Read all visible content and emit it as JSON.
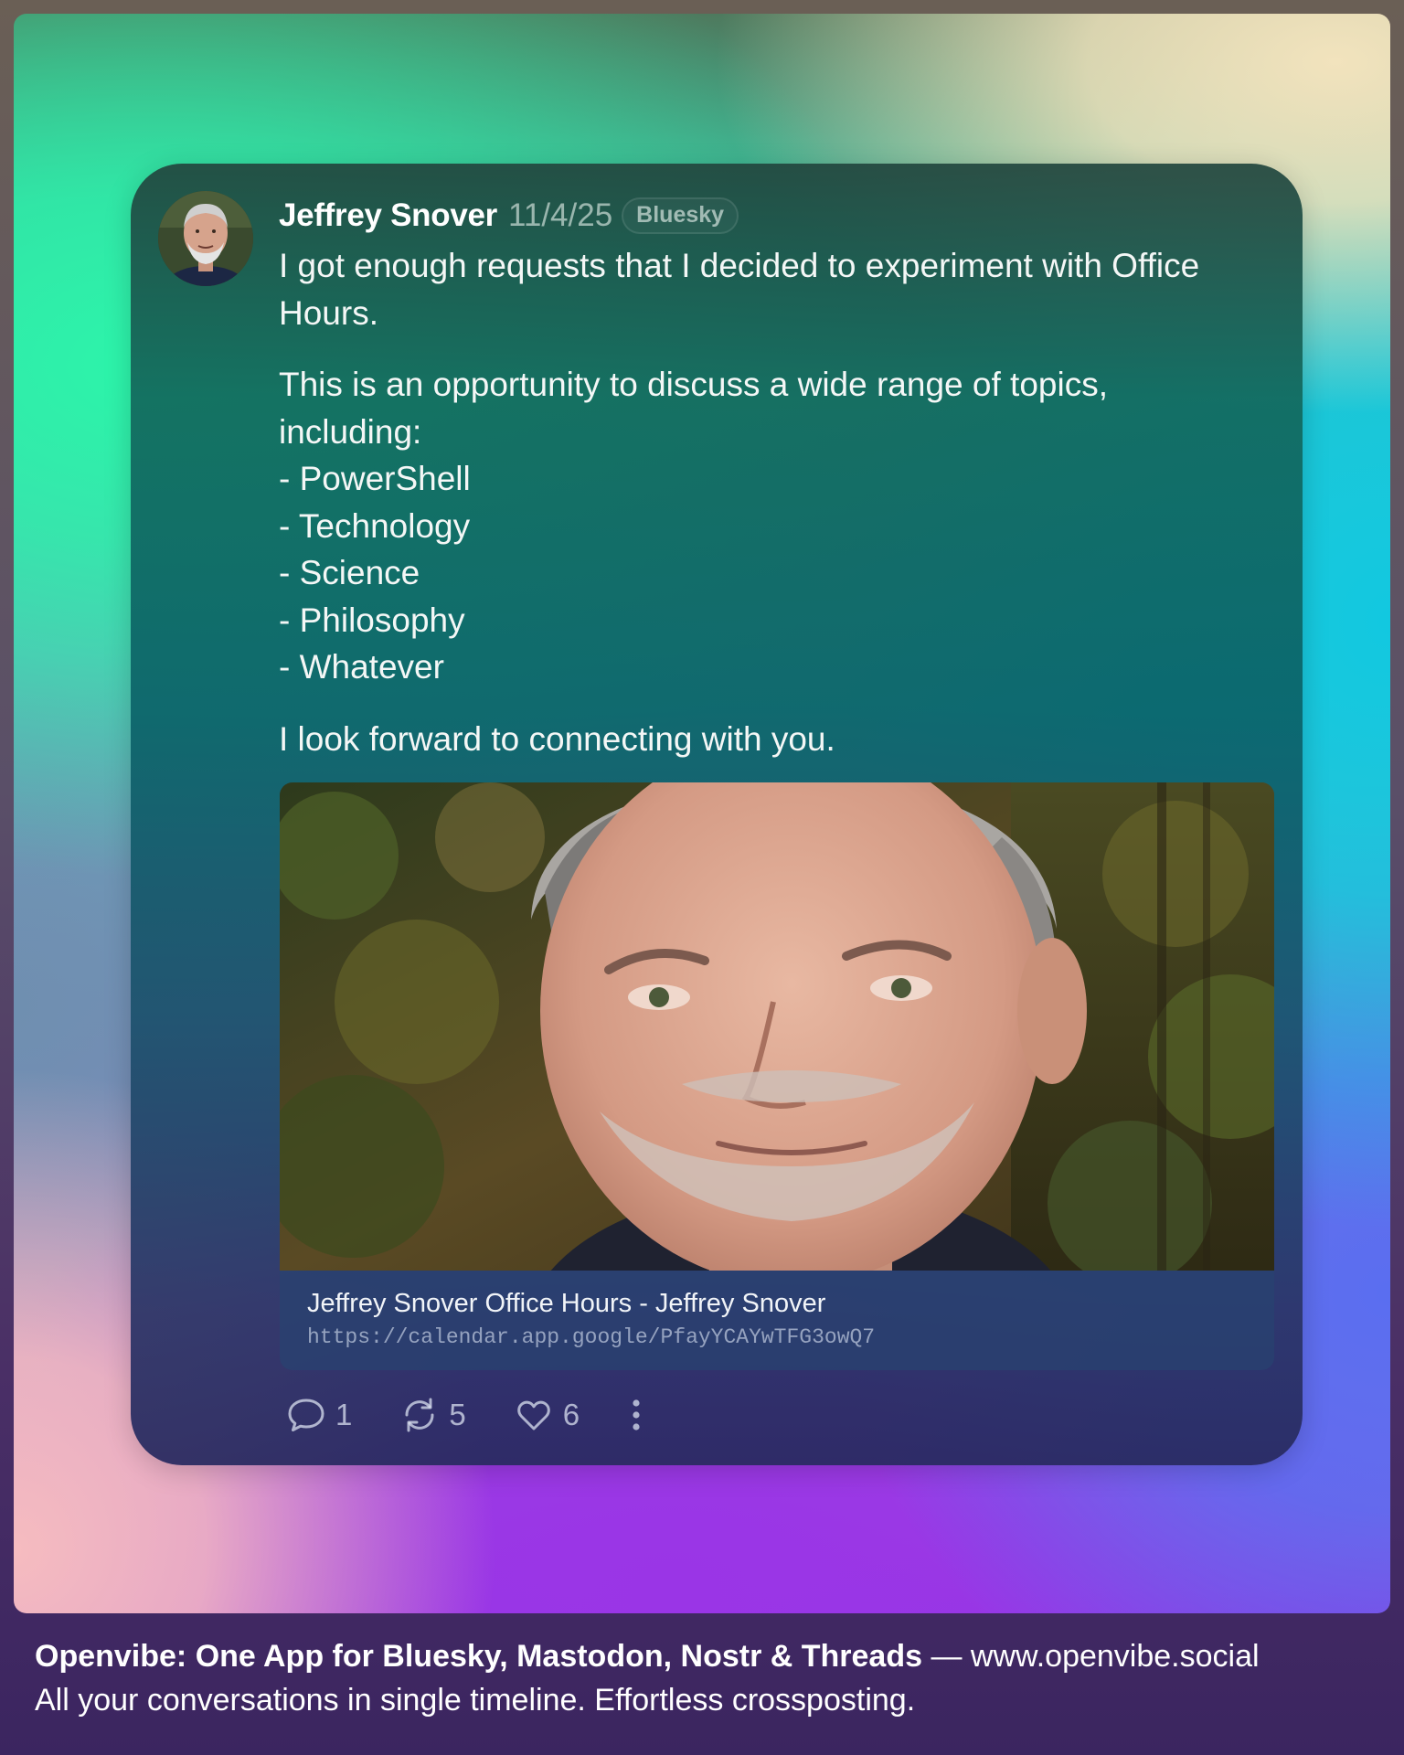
{
  "post": {
    "author": "Jeffrey Snover",
    "date": "11/4/25",
    "network": "Bluesky",
    "paragraph1": "I got enough requests that I decided to experiment with Office Hours.",
    "paragraph2_lines": [
      "This is an opportunity to discuss a wide range of topics,",
      "including:",
      "- PowerShell",
      "- Technology",
      "- Science",
      "- Philosophy",
      "- Whatever"
    ],
    "paragraph3": "I look forward to connecting with you.",
    "link_card": {
      "title": "Jeffrey Snover Office Hours - Jeffrey Snover",
      "url": "https://calendar.app.google/PfayYCAYwTFG3owQ7"
    },
    "stats": {
      "replies": "1",
      "reposts": "5",
      "likes": "6"
    }
  },
  "footer": {
    "headline": "Openvibe: One App for Bluesky, Mastodon, Nostr & Threads",
    "separator": " — ",
    "site": "www.openvibe.social",
    "tagline": "All your conversations in single timeline. Effortless crossposting."
  },
  "icons": {
    "reply": "speech-bubble-icon",
    "repost": "repost-arrows-icon",
    "like": "heart-icon",
    "more": "vertical-ellipsis-icon"
  }
}
